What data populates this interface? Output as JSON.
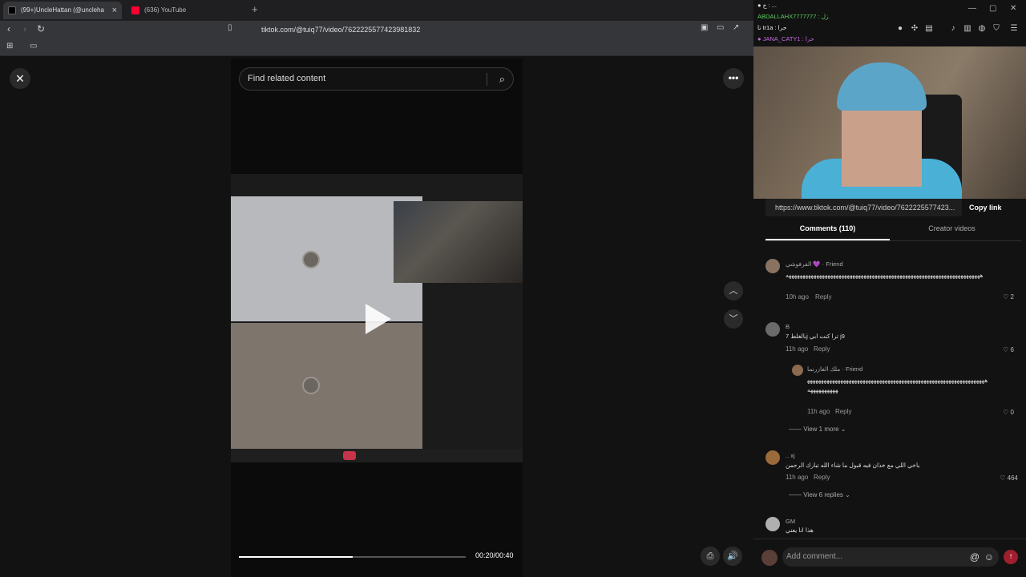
{
  "browser": {
    "tabs": [
      {
        "label": "(99+)UncleHattan (@uncleha",
        "color": "#e0e0e0"
      },
      {
        "label": "(636) YouTube",
        "color": "#ff0033"
      }
    ],
    "url": "tiktok.com/@tuiq77/video/7622225577423981832",
    "new_tab": "+"
  },
  "stage": {
    "close_icon": "×",
    "search_placeholder": "Find related content",
    "more_icon": "•••",
    "time": "00:20/00:40",
    "progress": 0.5,
    "nav_up": "︿",
    "nav_down": "﹀"
  },
  "chat": [
    {
      "text": "● ج : ...",
      "color": "#e04848"
    },
    {
      "text": "ABDALLAHX7777777 : زل",
      "color": "#5fd05f"
    },
    {
      "text": "تا tr1a : حرا",
      "color": "#e0e0e0"
    },
    {
      "text": "● JANA_CATY1 : حرا",
      "color": "#c66ae0"
    }
  ],
  "share": {
    "link": "https://www.tiktok.com/@tuiq77/video/7622225577423...",
    "copy_label": "Copy link"
  },
  "panel_tabs": {
    "comments": "Comments (110)",
    "creator": "Creator videos"
  },
  "comments": [
    {
      "name": "الفرفوشي 💜 · Friend",
      "text": "ههههههههههههههههههههههههههههههههههههههههههههههههههههههههههههههههههههههه",
      "time": "10h ago",
      "reply": "Reply",
      "likes": "2"
    },
    {
      "name": "B",
      "text": "بالغلط 7j ترا كنت ابي j9",
      "time": "11h ago",
      "reply": "Reply",
      "likes": "6"
    },
    {
      "name": "ملك الفازرنما · Friend",
      "text": "هههههههههههههههههههههههههههههههههههههههههههههههههههههههههههههههههههههههههههه",
      "time": "11h ago",
      "reply": "Reply",
      "likes": "0"
    },
    {
      "name": ".. xj",
      "text": "ياخي اللي مع خذان فيه قبول ما شاء الله تبارك الرحمن",
      "time": "11h ago",
      "reply": "Reply",
      "likes": "464"
    },
    {
      "name": "GM",
      "text": "هذا انا يعني",
      "time": "",
      "reply": "",
      "likes": ""
    }
  ],
  "view_more": {
    "one": "View 1 more",
    "six": "View 6 replies"
  },
  "composer": {
    "placeholder": "Add comment...",
    "mention_icon": "@",
    "emoji_icon": "☺",
    "send_icon": "↑"
  },
  "colors": {
    "accent": "#a01e2e",
    "end_call": "#c6344a"
  }
}
